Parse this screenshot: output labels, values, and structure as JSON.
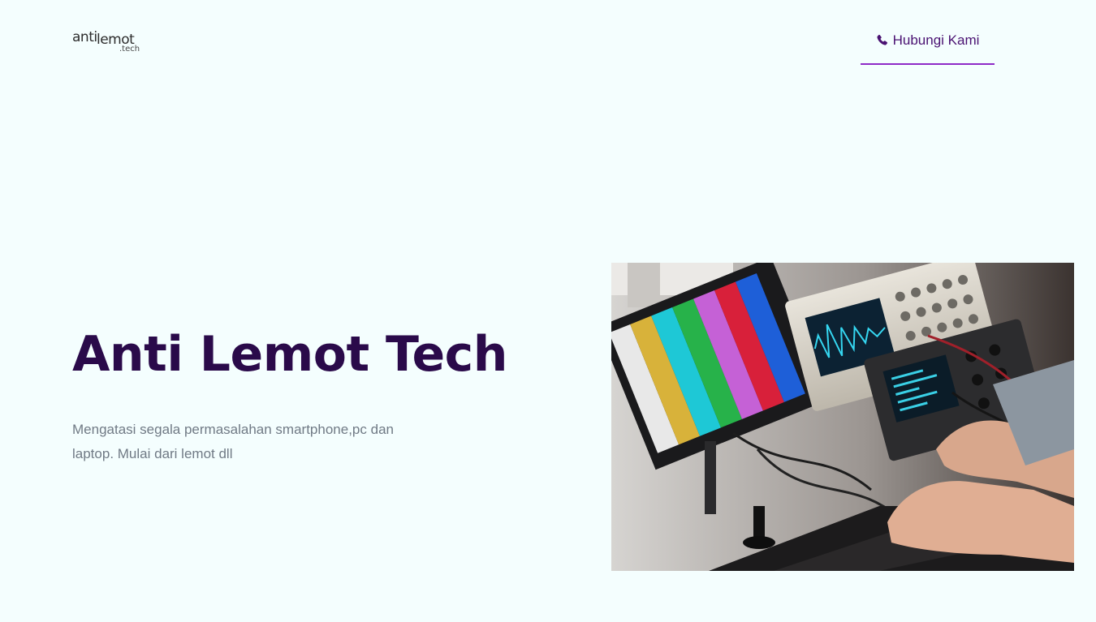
{
  "logo": {
    "part1": "anti",
    "part2": "lemot",
    "part3": ".tech"
  },
  "nav": {
    "contact_label": "Hubungi Kami",
    "contact_icon": "phone-icon",
    "accent_color": "#8e2bc7"
  },
  "hero": {
    "title": "Anti Lemot Tech",
    "description": "Mengatasi segala permasalahan smartphone,pc dan laptop. Mulai dari lemot dll",
    "image_subject": "electronics-repair-workbench-photo"
  },
  "colors": {
    "background": "#f4fefe",
    "title": "#2a0a4a",
    "text": "#707a85",
    "link": "#4a1272"
  }
}
